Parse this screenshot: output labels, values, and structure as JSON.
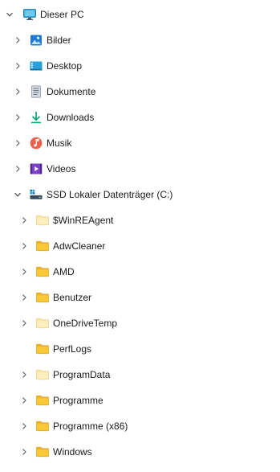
{
  "tree": {
    "root": {
      "label": "Dieser PC",
      "icon": "monitor-icon",
      "expanded": true
    },
    "libraries": [
      {
        "label": "Bilder",
        "icon": "pictures-icon"
      },
      {
        "label": "Desktop",
        "icon": "desktop-icon"
      },
      {
        "label": "Dokumente",
        "icon": "documents-icon"
      },
      {
        "label": "Downloads",
        "icon": "downloads-icon"
      },
      {
        "label": "Musik",
        "icon": "music-icon"
      },
      {
        "label": "Videos",
        "icon": "videos-icon"
      }
    ],
    "drive": {
      "label": "SSD Lokaler Datenträger (C:)",
      "icon": "drive-icon",
      "expanded": true
    },
    "folders": [
      {
        "label": "$WinREAgent",
        "icon": "folder-icon",
        "has_children": true,
        "hidden": true
      },
      {
        "label": "AdwCleaner",
        "icon": "folder-icon",
        "has_children": true,
        "hidden": false
      },
      {
        "label": "AMD",
        "icon": "folder-icon",
        "has_children": true,
        "hidden": false
      },
      {
        "label": "Benutzer",
        "icon": "folder-icon",
        "has_children": true,
        "hidden": false
      },
      {
        "label": "OneDriveTemp",
        "icon": "folder-icon",
        "has_children": true,
        "hidden": true
      },
      {
        "label": "PerfLogs",
        "icon": "folder-icon",
        "has_children": false,
        "hidden": false
      },
      {
        "label": "ProgramData",
        "icon": "folder-icon",
        "has_children": true,
        "hidden": true
      },
      {
        "label": "Programme",
        "icon": "folder-icon",
        "has_children": true,
        "hidden": false
      },
      {
        "label": "Programme (x86)",
        "icon": "folder-icon",
        "has_children": true,
        "hidden": false
      },
      {
        "label": "Windows",
        "icon": "folder-icon",
        "has_children": true,
        "hidden": false
      }
    ]
  },
  "colors": {
    "text": "#1a1a1a",
    "chevron": "#5c5c5c",
    "folder": "#f8c837",
    "folder_light": "#fbe3a2",
    "folder_hidden": "#fdeebf",
    "monitor": "#2aa0d8",
    "pictures": "#1f7ad1",
    "desktop": "#2a9fd8",
    "documents": "#8e96a0",
    "downloads": "#15a77c",
    "music": "#e8624f",
    "videos": "#7a3fc4",
    "drive": "#3a4a5a"
  }
}
